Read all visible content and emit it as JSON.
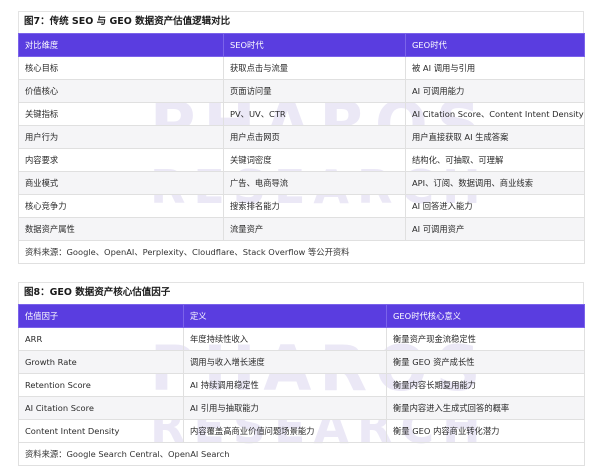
{
  "table1": {
    "title": "图7：传统 SEO 与 GEO 数据资产估值逻辑对比",
    "headers": [
      "对比维度",
      "SEO时代",
      "GEO时代"
    ],
    "rows": [
      [
        "核心目标",
        "获取点击与流量",
        "被 AI 调用与引用"
      ],
      [
        "价值核心",
        "页面访问量",
        "AI 可调用能力"
      ],
      [
        "关键指标",
        "PV、UV、CTR",
        "AI Citation Score、Content Intent Density"
      ],
      [
        "用户行为",
        "用户点击网页",
        "用户直接获取 AI 生成答案"
      ],
      [
        "内容要求",
        "关键词密度",
        "结构化、可抽取、可理解"
      ],
      [
        "商业模式",
        "广告、电商导流",
        "API、订阅、数据调用、商业线索"
      ],
      [
        "核心竞争力",
        "搜索排名能力",
        "AI 回答进入能力"
      ],
      [
        "数据资产属性",
        "流量资产",
        "AI 可调用资产"
      ]
    ],
    "source": "资料来源：Google、OpenAI、Perplexity、Cloudflare、Stack Overflow 等公开资料"
  },
  "table2": {
    "title": "图8：GEO 数据资产核心估值因子",
    "headers": [
      "估值因子",
      "定义",
      "GEO时代核心意义"
    ],
    "rows": [
      [
        "ARR",
        "年度持续性收入",
        "衡量资产现金流稳定性"
      ],
      [
        "Growth Rate",
        "调用与收入增长速度",
        "衡量 GEO 资产成长性"
      ],
      [
        "Retention Score",
        "AI 持续调用稳定性",
        "衡量内容长期复用能力"
      ],
      [
        "AI Citation Score",
        "AI 引用与抽取能力",
        "衡量内容进入生成式回答的概率"
      ],
      [
        "Content Intent Density",
        "内容覆盖高商业价值问题场景能力",
        "衡量 GEO 内容商业转化潜力"
      ]
    ],
    "source": "资料来源：Google Search Central、OpenAI Search"
  },
  "watermark": {
    "line1": "PHAROS",
    "line2": "RESEARCH"
  },
  "colors": {
    "header_bg": "#5a3de0",
    "watermark": "#c8bfe8"
  }
}
